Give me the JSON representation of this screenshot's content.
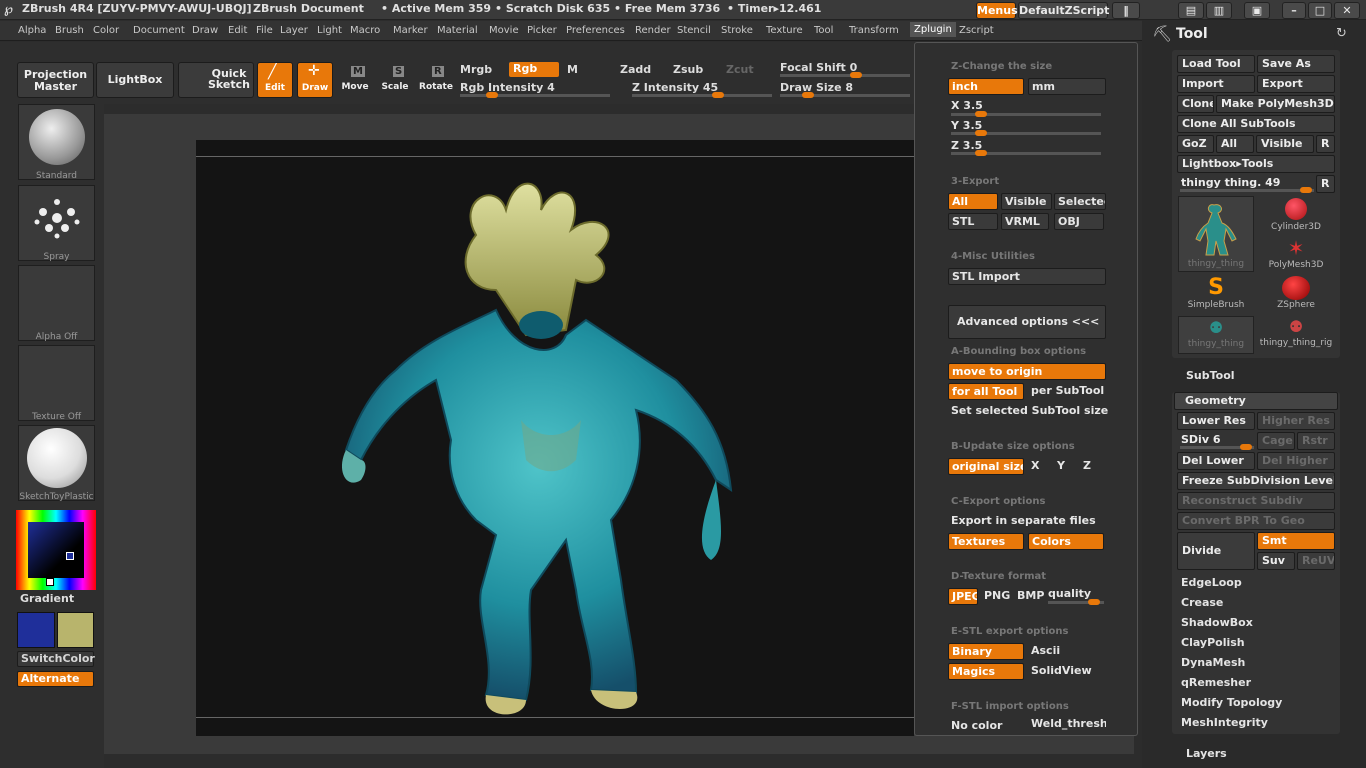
{
  "title_bar": {
    "app_title": "ZBrush 4R4 [ZUYV-PMVY-AWUJ-UBQJ]",
    "document": "ZBrush Document",
    "active_mem": "• Active Mem 359",
    "scratch_disk": "• Scratch Disk 635",
    "free_mem": "• Free Mem 3736",
    "timer": "• Timer▸12.461",
    "menus_button": "Menus",
    "default_zscript": "DefaultZScript"
  },
  "menu": {
    "items": [
      "Alpha",
      "Brush",
      "Color",
      "Document",
      "Draw",
      "Edit",
      "File",
      "Layer",
      "Light",
      "Macro",
      "Marker",
      "Material",
      "Movie",
      "Picker",
      "Preferences",
      "Render",
      "Stencil",
      "Stroke",
      "Texture",
      "Tool",
      "Transform",
      "Zplugin",
      "Zscript"
    ],
    "active": "Zplugin"
  },
  "toolbar": {
    "projection_master": "Projection Master",
    "lightbox": "LightBox",
    "quick_sketch": "Quick Sketch",
    "edit": "Edit",
    "draw": "Draw",
    "move": "Move",
    "scale": "Scale",
    "rotate": "Rotate",
    "mrgb": "Mrgb",
    "rgb": "Rgb",
    "m": "M",
    "zadd": "Zadd",
    "zsub": "Zsub",
    "zcut": "Zcut",
    "rgb_intensity": "Rgb Intensity 4",
    "z_intensity": "Z Intensity 45",
    "focal_shift": "Focal Shift 0",
    "draw_size": "Draw Size 8",
    "rgb_intensity_value": 4,
    "z_intensity_value": 45,
    "draw_size_value": 8
  },
  "shelf": {
    "standard": "Standard",
    "spray": "Spray",
    "alpha_off": "Alpha Off",
    "texture_off": "Texture Off",
    "material": "SketchToyPlastic",
    "gradient": "Gradient",
    "switch_color": "SwitchColor",
    "alternate": "Alternate",
    "colors": {
      "primary": "#1f2f9a",
      "secondary": "#b8b46c"
    }
  },
  "zplugin": {
    "change_size": "Z-Change the size",
    "inch": "inch",
    "mm": "mm",
    "x": "X 3.5",
    "y": "Y 3.5",
    "z": "Z 3.5",
    "export_header": "3-Export",
    "all": "All",
    "visible": "Visible",
    "selected": "Selected",
    "stl": "STL",
    "vrml": "VRML",
    "obj": "OBJ",
    "misc_header": "4-Misc Utilities",
    "stl_import": "STL Import",
    "advanced": "Advanced options <<<",
    "bbox_header": "A-Bounding box options",
    "move_to_origin": "move to origin",
    "for_all_tool": "for all Tool",
    "per_subtool": "per SubTool",
    "set_selected": "Set selected SubTool size",
    "update_header": "B-Update size options",
    "original_size": "original size",
    "ux": "X",
    "uy": "Y",
    "uz": "Z",
    "cexport_header": "C-Export options",
    "export_separate": "Export in separate files",
    "textures": "Textures",
    "colors": "Colors",
    "dtex_header": "D-Texture format",
    "jpeg": "JPEG",
    "png": "PNG",
    "bmp": "BMP",
    "quality": "quality",
    "estl_header": "E-STL export options",
    "binary": "Binary",
    "ascii": "Ascii",
    "magics": "Magics",
    "solidview": "SolidView",
    "fstl_header": "F-STL import options",
    "no_color": "No color",
    "weld": "Weld_threshold"
  },
  "tool": {
    "title": "Tool",
    "load_tool": "Load Tool",
    "save_as": "Save As",
    "import": "Import",
    "export": "Export",
    "clone": "Clone",
    "make_polymesh": "Make PolyMesh3D",
    "clone_all": "Clone All SubTools",
    "goz": "GoZ",
    "all": "All",
    "visible": "Visible",
    "r": "R",
    "lightbox_tools": "Lightbox▸Tools",
    "current_tool": "thingy thing. 49",
    "thumbs": [
      {
        "label": "thingy_thing"
      },
      {
        "label": "Cylinder3D"
      },
      {
        "label": "PolyMesh3D"
      },
      {
        "label": "SimpleBrush"
      },
      {
        "label": "ZSphere"
      },
      {
        "label": "thingy_thing"
      },
      {
        "label": "thingy_thing_rig"
      }
    ],
    "subtool": "SubTool",
    "geometry": "Geometry",
    "lower_res": "Lower Res",
    "higher_res": "Higher Res",
    "sdiv": "SDiv 6",
    "cage": "Cage",
    "rstr": "Rstr",
    "del_lower": "Del Lower",
    "del_higher": "Del Higher",
    "freeze": "Freeze SubDivision Levels",
    "reconstruct": "Reconstruct Subdiv",
    "convert_bpr": "Convert BPR To Geo",
    "divide": "Divide",
    "smt": "Smt",
    "suv": "Suv",
    "reuv": "ReUV",
    "edgeloop": "EdgeLoop",
    "crease": "Crease",
    "shadowbox": "ShadowBox",
    "claypolish": "ClayPolish",
    "dynamesh": "DynaMesh",
    "qremesher": "qRemesher",
    "modify_topology": "Modify Topology",
    "meshintegrity": "MeshIntegrity",
    "layers": "Layers"
  }
}
